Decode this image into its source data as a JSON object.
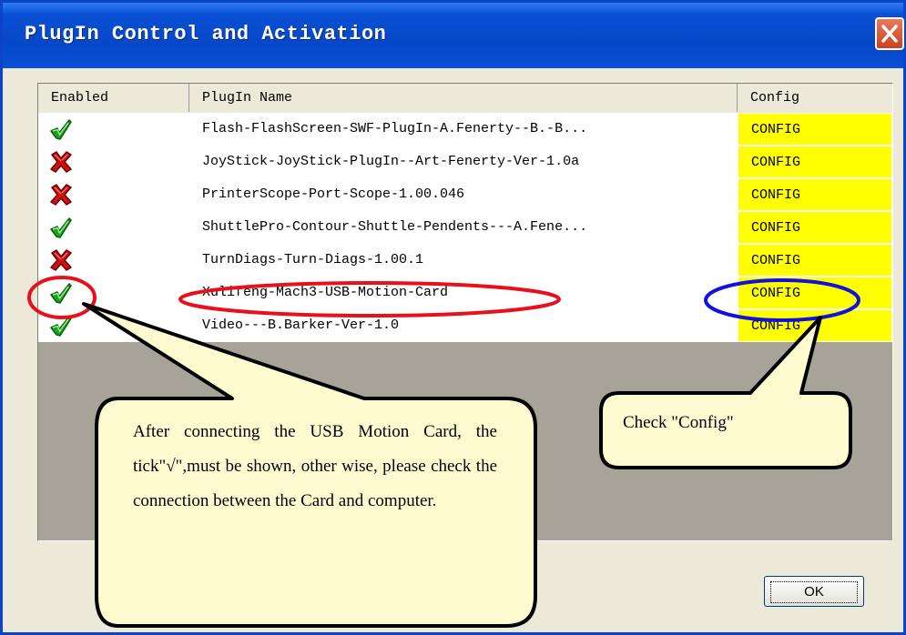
{
  "window": {
    "title": "PlugIn Control and Activation"
  },
  "columns": {
    "enabled": "Enabled",
    "name": "PlugIn Name",
    "config": "Config"
  },
  "plugins": [
    {
      "enabled": true,
      "name": "Flash-FlashScreen-SWF-PlugIn-A.Fenerty--B.-B...",
      "config": "CONFIG"
    },
    {
      "enabled": false,
      "name": "JoyStick-JoyStick-PlugIn--Art-Fenerty-Ver-1.0a",
      "config": "CONFIG"
    },
    {
      "enabled": false,
      "name": "PrinterScope-Port-Scope-1.00.046",
      "config": "CONFIG"
    },
    {
      "enabled": true,
      "name": "ShuttlePro-Contour-Shuttle-Pendents---A.Fene...",
      "config": "CONFIG"
    },
    {
      "enabled": false,
      "name": "TurnDiags-Turn-Diags-1.00.1",
      "config": "CONFIG"
    },
    {
      "enabled": true,
      "name": "Xulifeng-Mach3-USB-Motion-Card",
      "config": "CONFIG"
    },
    {
      "enabled": true,
      "name": "Video---B.Barker-Ver-1.0",
      "config": "CONFIG"
    }
  ],
  "buttons": {
    "ok": "OK"
  },
  "annotations": {
    "left": "After connecting the USB Motion Card, the tick\"√\",must be shown, other wise, please check the connection between  the Card and computer.",
    "right": "Check \"Config\""
  },
  "colors": {
    "titlebar": "#0a4fd5",
    "config_bg": "#ffff00",
    "callout_fill": "#fffbd0",
    "highlight_red": "#e8101a",
    "highlight_blue": "#1010e0",
    "tick_green": "#1aa51a",
    "cross_red": "#d01010"
  },
  "icons": {
    "enabled_true": "green-check-icon",
    "enabled_false": "red-x-icon"
  }
}
